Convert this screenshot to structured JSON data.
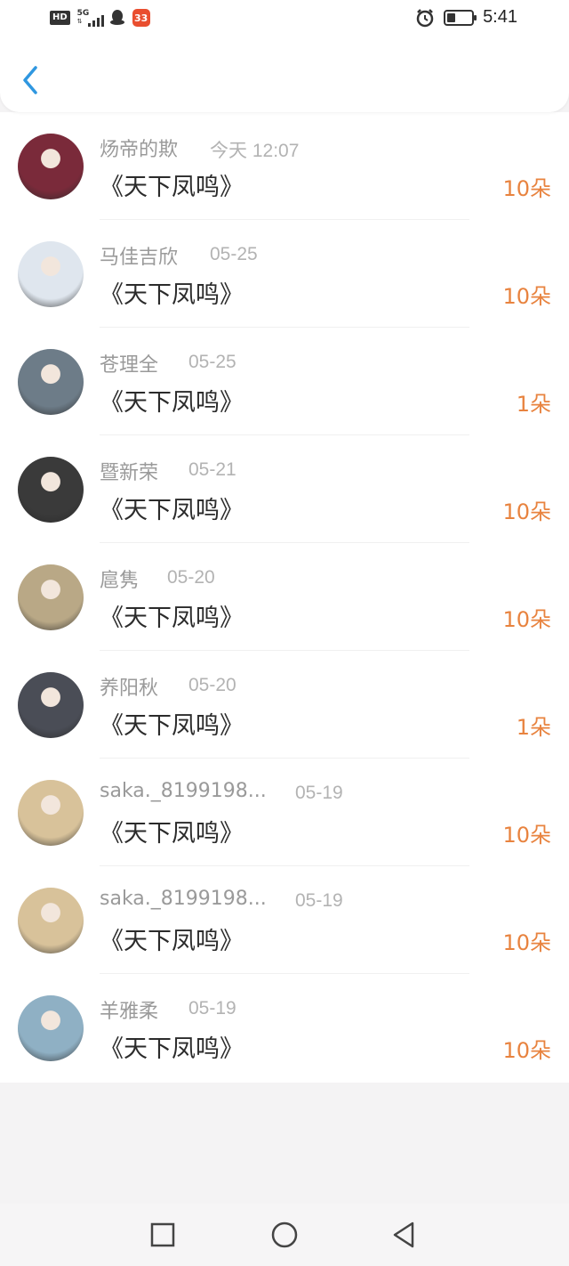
{
  "status_bar": {
    "hd": "HD",
    "network": "5G",
    "app_badge": "33",
    "time": "5:41",
    "battery_level": 0.35
  },
  "header": {
    "back_icon": "chevron-left-icon"
  },
  "list": {
    "items": [
      {
        "name": "炀帝的欺",
        "date": "今天 12:07",
        "title": "《天下凤鸣》",
        "amount": "10朵",
        "avatar_color": "#7a2a3a"
      },
      {
        "name": "马佳吉欣",
        "date": "05-25",
        "title": "《天下凤鸣》",
        "amount": "10朵",
        "avatar_color": "#dfe6ee"
      },
      {
        "name": "苍理全",
        "date": "05-25",
        "title": "《天下凤鸣》",
        "amount": "1朵",
        "avatar_color": "#6d7c88"
      },
      {
        "name": "暨新荣",
        "date": "05-21",
        "title": "《天下凤鸣》",
        "amount": "10朵",
        "avatar_color": "#3a3a3a"
      },
      {
        "name": "扈隽",
        "date": "05-20",
        "title": "《天下凤鸣》",
        "amount": "10朵",
        "avatar_color": "#b9a886"
      },
      {
        "name": "养阳秋",
        "date": "05-20",
        "title": "《天下凤鸣》",
        "amount": "1朵",
        "avatar_color": "#4a4d56"
      },
      {
        "name": "saka._8199198...",
        "date": "05-19",
        "title": "《天下凤鸣》",
        "amount": "10朵",
        "avatar_color": "#d8c29a"
      },
      {
        "name": "saka._8199198...",
        "date": "05-19",
        "title": "《天下凤鸣》",
        "amount": "10朵",
        "avatar_color": "#d8c29a"
      },
      {
        "name": "羊雅柔",
        "date": "05-19",
        "title": "《天下凤鸣》",
        "amount": "10朵",
        "avatar_color": "#8fb0c4"
      }
    ]
  },
  "navbar": {
    "recent_icon": "square-icon",
    "home_icon": "circle-icon",
    "back_icon": "triangle-back-icon"
  },
  "colors": {
    "accent_blue": "#2f97e0",
    "amount_orange": "#e8833f"
  }
}
